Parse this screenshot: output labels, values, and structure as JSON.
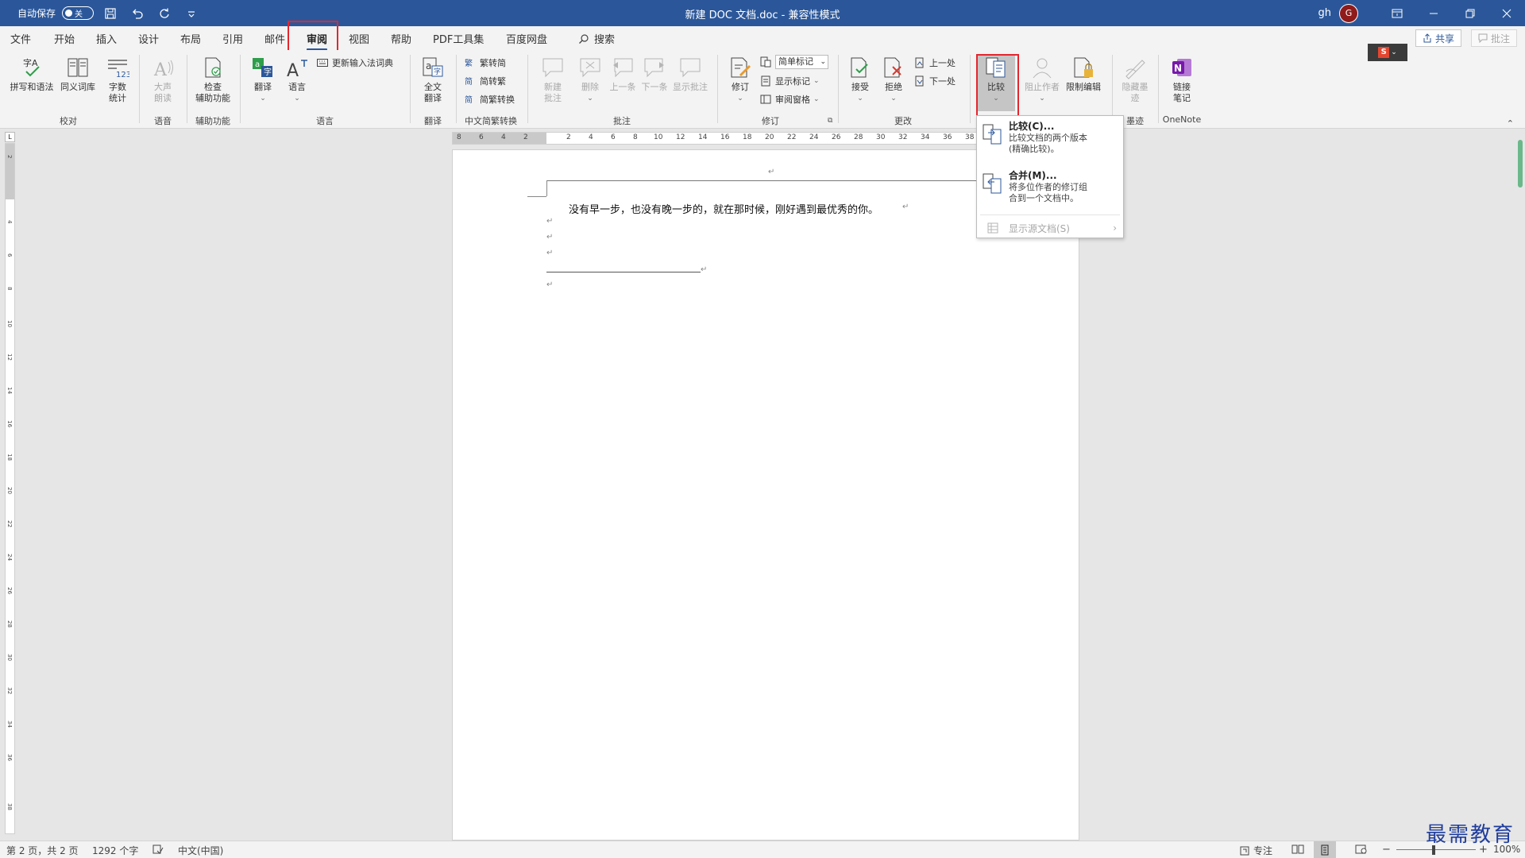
{
  "titlebar": {
    "autosave_label": "自动保存",
    "autosave_state": "关",
    "doc_title": "新建 DOC 文档.doc  -  兼容性模式",
    "user_name": "gh",
    "avatar_letter": "G"
  },
  "tabs": [
    "文件",
    "开始",
    "插入",
    "设计",
    "布局",
    "引用",
    "邮件",
    "审阅",
    "视图",
    "帮助",
    "PDF工具集",
    "百度网盘"
  ],
  "search_label": "搜索",
  "share_label": "共享",
  "comments_label": "批注",
  "ribbon": {
    "proofing": {
      "label": "校对",
      "spelling": "拼写和语法",
      "thesaurus": "同义词库",
      "wordcount_l1": "字数",
      "wordcount_l2": "统计",
      "abc_glyph": "字A",
      "num_glyph": "123"
    },
    "speech": {
      "label": "语音",
      "read_l1": "大声",
      "read_l2": "朗读"
    },
    "accessibility": {
      "label": "辅助功能",
      "check_l1": "检查",
      "check_l2": "辅助功能"
    },
    "language": {
      "label": "语言",
      "translate": "翻译",
      "language": "语言",
      "update_ime": "更新输入法词典"
    },
    "translation": {
      "label": "翻译",
      "full_l1": "全文",
      "full_l2": "翻译"
    },
    "chinese_conv": {
      "label": "中文简繁转换",
      "to_simplified": "繁转简",
      "to_traditional": "简转繁",
      "convert": "简繁转换"
    },
    "comments": {
      "label": "批注",
      "new_l1": "新建",
      "new_l2": "批注",
      "delete": "删除",
      "previous": "上一条",
      "next": "下一条",
      "show": "显示批注"
    },
    "tracking": {
      "label": "修订",
      "track": "修订",
      "markup": "简单标记",
      "show_markup": "显示标记",
      "review_pane": "审阅窗格"
    },
    "changes": {
      "label": "更改",
      "accept": "接受",
      "reject": "拒绝",
      "previous": "上一处",
      "next": "下一处"
    },
    "compare": {
      "label": "比较",
      "compare": "比较"
    },
    "protect": {
      "block_authors": "阻止作者",
      "restrict": "限制编辑"
    },
    "ink": {
      "label": "墨迹",
      "hide_l1": "隐藏墨",
      "hide_l2": "迹"
    },
    "onenote": {
      "label": "OneNote",
      "link_l1": "链接",
      "link_l2": "笔记"
    }
  },
  "compare_menu": {
    "compare_title": "比较(C)...",
    "compare_desc_1": "比较文档的两个版本",
    "compare_desc_2": "(精确比较)。",
    "combine_title": "合并(M)...",
    "combine_desc_1": "将多位作者的修订组",
    "combine_desc_2": "合到一个文档中。",
    "show_source": "显示源文档(S)"
  },
  "ruler_ticks_h": [
    "8",
    "6",
    "4",
    "2",
    "2",
    "4",
    "6",
    "8",
    "10",
    "12",
    "14",
    "16",
    "18",
    "20",
    "22",
    "24",
    "26",
    "28",
    "30",
    "32",
    "34",
    "36",
    "38"
  ],
  "ruler_ticks_v": [
    "2",
    "4",
    "6",
    "8",
    "10",
    "12",
    "14",
    "16",
    "18",
    "20",
    "22",
    "24",
    "26",
    "28",
    "30",
    "32",
    "34",
    "36",
    "38"
  ],
  "document": {
    "text": "没有早一步，也没有晚一步的，就在那时候，刚好遇到最优秀的你。"
  },
  "status": {
    "page": "第 2 页，共 2 页",
    "words": "1292 个字",
    "language": "中文(中国)",
    "focus": "专注",
    "zoom": "100%"
  },
  "watermark": "最需教育",
  "colors": {
    "accent": "#2b579a",
    "highlight": "#e3262f",
    "avatar": "#8f1b1b"
  }
}
